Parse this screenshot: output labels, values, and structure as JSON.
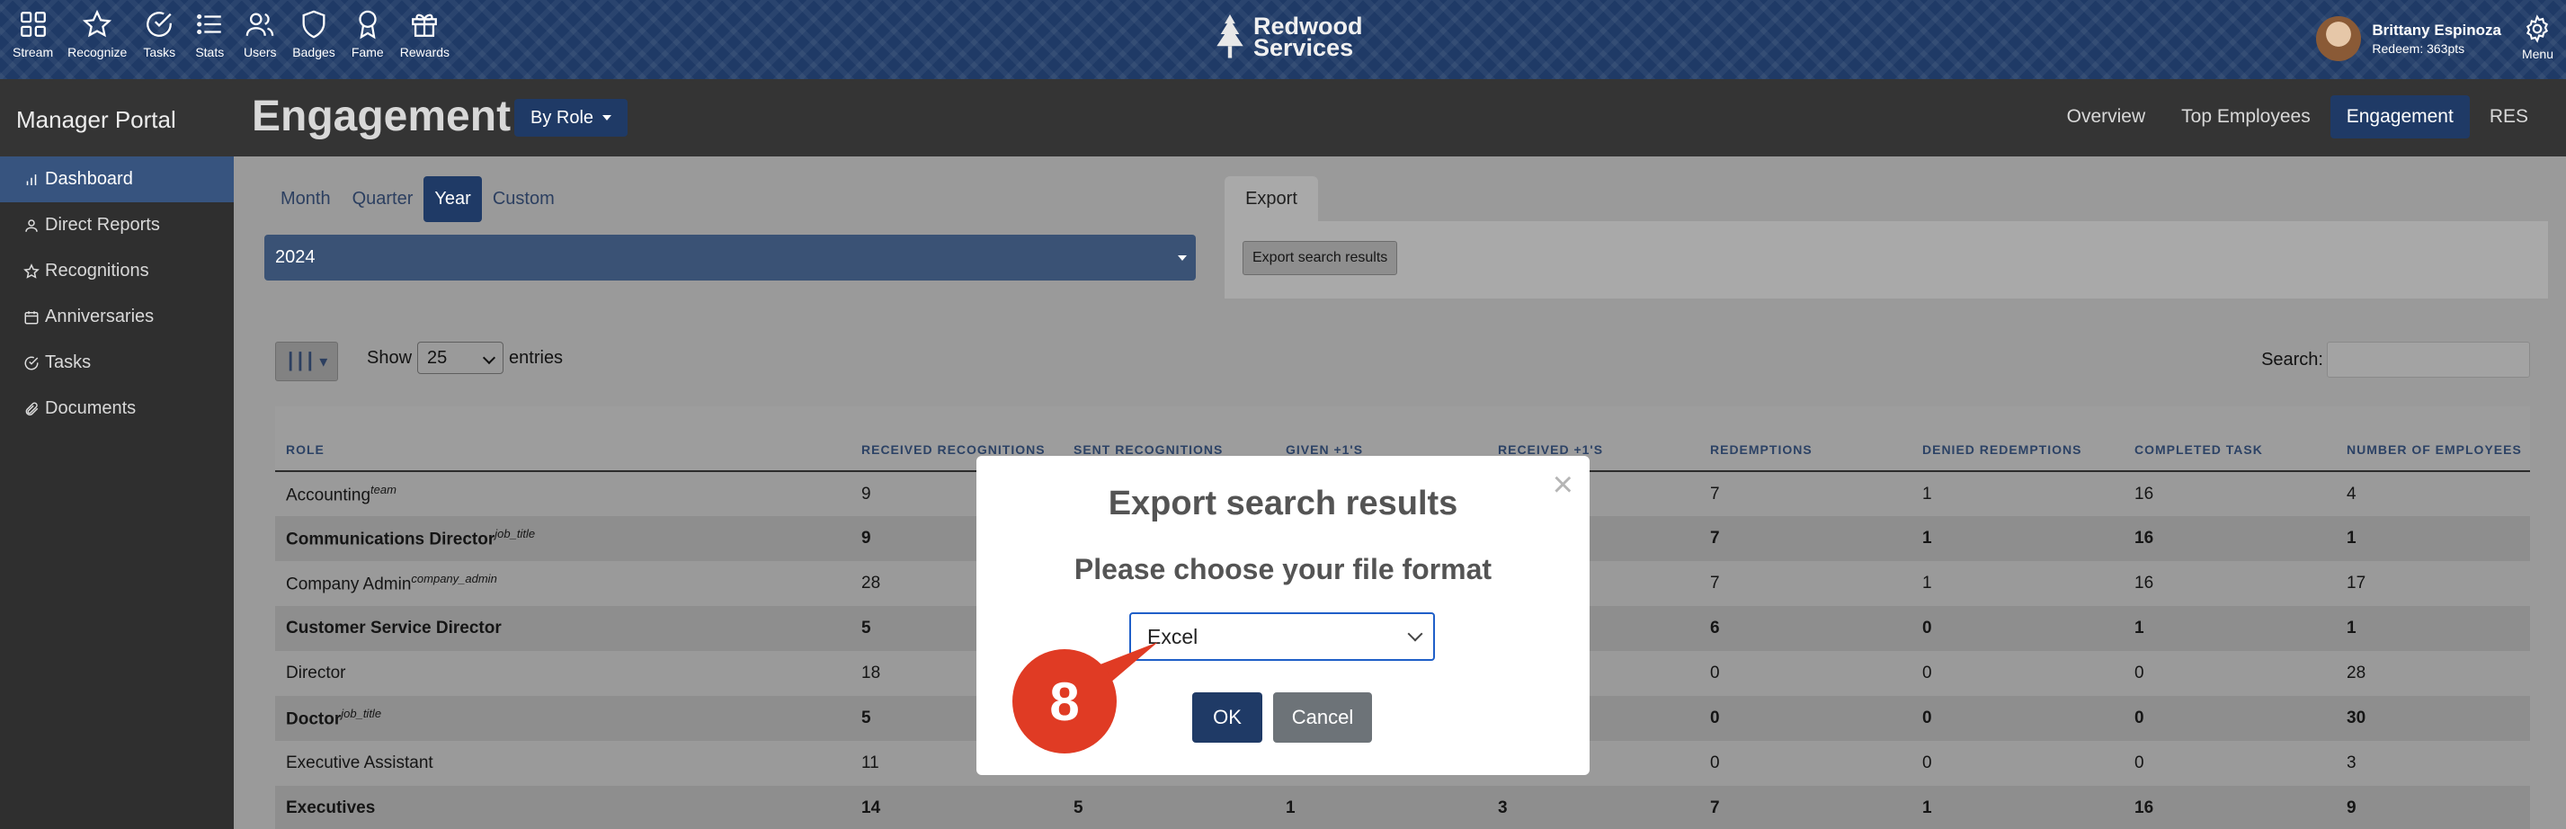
{
  "topnav": {
    "items": [
      {
        "label": "Stream",
        "icon": "grid-icon"
      },
      {
        "label": "Recognize",
        "icon": "star-icon"
      },
      {
        "label": "Tasks",
        "icon": "check-circle-icon"
      },
      {
        "label": "Stats",
        "icon": "list-icon"
      },
      {
        "label": "Users",
        "icon": "users-icon"
      },
      {
        "label": "Badges",
        "icon": "shield-icon"
      },
      {
        "label": "Fame",
        "icon": "award-icon"
      },
      {
        "label": "Rewards",
        "icon": "gift-icon"
      }
    ],
    "brand_line1": "Redwood",
    "brand_line2": "Services",
    "user_name": "Brittany Espinoza",
    "user_points": "Redeem: 363pts",
    "menu_label": "Menu"
  },
  "header": {
    "portal_title": "Manager Portal",
    "page_title": "Engagement",
    "role_button": "By Role",
    "tabs": [
      "Overview",
      "Top Employees",
      "Engagement",
      "RES"
    ],
    "active_tab": "Engagement"
  },
  "sidebar": {
    "items": [
      {
        "label": "Dashboard",
        "icon": "bar-chart-icon",
        "active": true
      },
      {
        "label": "Direct Reports",
        "icon": "user-icon"
      },
      {
        "label": "Recognitions",
        "icon": "star-icon"
      },
      {
        "label": "Anniversaries",
        "icon": "calendar-icon"
      },
      {
        "label": "Tasks",
        "icon": "check-circle-icon"
      },
      {
        "label": "Documents",
        "icon": "paperclip-icon"
      }
    ]
  },
  "filters": {
    "periods": [
      "Month",
      "Quarter",
      "Year",
      "Custom"
    ],
    "active_period": "Year",
    "year_value": "2024"
  },
  "export": {
    "tab_label": "Export",
    "button_label": "Export search results"
  },
  "table_controls": {
    "show_label": "Show",
    "entries_value": "25",
    "entries_label": "entries",
    "search_label": "Search:"
  },
  "table": {
    "columns": [
      "ROLE",
      "RECEIVED RECOGNITIONS",
      "SENT RECOGNITIONS",
      "GIVEN +1'S",
      "RECEIVED +1'S",
      "REDEMPTIONS",
      "DENIED REDEMPTIONS",
      "COMPLETED TASK",
      "NUMBER OF EMPLOYEES"
    ],
    "rows": [
      {
        "role": "Accounting",
        "tag": "team",
        "received": "9",
        "sent": "",
        "given": "",
        "received_plus": "",
        "redemptions": "7",
        "denied": "1",
        "completed": "16",
        "employees": "4"
      },
      {
        "role": "Communications Director",
        "tag": "job_title",
        "received": "9",
        "sent": "",
        "given": "",
        "received_plus": "",
        "redemptions": "7",
        "denied": "1",
        "completed": "16",
        "employees": "1"
      },
      {
        "role": "Company Admin",
        "tag": "company_admin",
        "received": "28",
        "sent": "",
        "given": "",
        "received_plus": "",
        "redemptions": "7",
        "denied": "1",
        "completed": "16",
        "employees": "17"
      },
      {
        "role": "Customer Service Director",
        "tag": "",
        "received": "5",
        "sent": "",
        "given": "",
        "received_plus": "",
        "redemptions": "6",
        "denied": "0",
        "completed": "1",
        "employees": "1"
      },
      {
        "role": "Director",
        "tag": "",
        "received": "18",
        "sent": "",
        "given": "",
        "received_plus": "",
        "redemptions": "0",
        "denied": "0",
        "completed": "0",
        "employees": "28"
      },
      {
        "role": "Doctor",
        "tag": "job_title",
        "received": "5",
        "sent": "",
        "given": "",
        "received_plus": "",
        "redemptions": "0",
        "denied": "0",
        "completed": "0",
        "employees": "30"
      },
      {
        "role": "Executive Assistant",
        "tag": "",
        "received": "11",
        "sent": "",
        "given": "",
        "received_plus": "",
        "redemptions": "0",
        "denied": "0",
        "completed": "0",
        "employees": "3"
      },
      {
        "role": "Executives",
        "tag": "",
        "received": "14",
        "sent": "5",
        "given": "1",
        "received_plus": "3",
        "redemptions": "7",
        "denied": "1",
        "completed": "16",
        "employees": "9"
      }
    ]
  },
  "modal": {
    "title": "Export search results",
    "subtitle": "Please choose your file format",
    "format_value": "Excel",
    "ok_label": "OK",
    "cancel_label": "Cancel"
  },
  "annotation": {
    "step_number": "8",
    "color": "#e03b24"
  }
}
